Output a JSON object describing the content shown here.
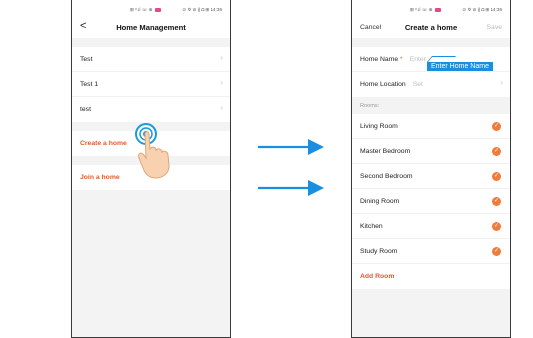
{
  "colors": {
    "accent": "#e8582a",
    "check": "#f07c3c",
    "annotation_blue": "#1a8fe0",
    "frame": "#3a3a3a",
    "background": "#f3f3f3"
  },
  "left_screen": {
    "status": {
      "left": "⊞ ᵒ.ıl ☏ ⊕",
      "right": "⊙ ✲ ⊘ ∦ ◘ ⊞ 14:36"
    },
    "title": "Home Management",
    "back_icon": "<",
    "homes": [
      "Test",
      "Test 1",
      "test"
    ],
    "create_home": "Create a home",
    "join_home": "Join a home",
    "chevron": "›"
  },
  "right_screen": {
    "status": {
      "left": "⊞ ᵒ.ıl ☏ ⊕",
      "right": "⊙ ✲ ⊘ ∦ ◘ ⊞ 14:36"
    },
    "cancel": "Cancel",
    "title": "Create a home",
    "save": "Save",
    "home_name_label": "Home Name",
    "required_mark": "*",
    "home_name_placeholder": "Enter",
    "home_location_label": "Home Location",
    "home_location_value": "Set",
    "rooms_label": "Rooms:",
    "rooms": [
      "Living Room",
      "Master Bedroom",
      "Second Bedroom",
      "Dining Room",
      "Kitchen",
      "Study Room"
    ],
    "add_room": "Add Room",
    "chevron": "›",
    "check_glyph": "✓"
  },
  "annotation": {
    "tooltip": "Enter Home Name"
  }
}
